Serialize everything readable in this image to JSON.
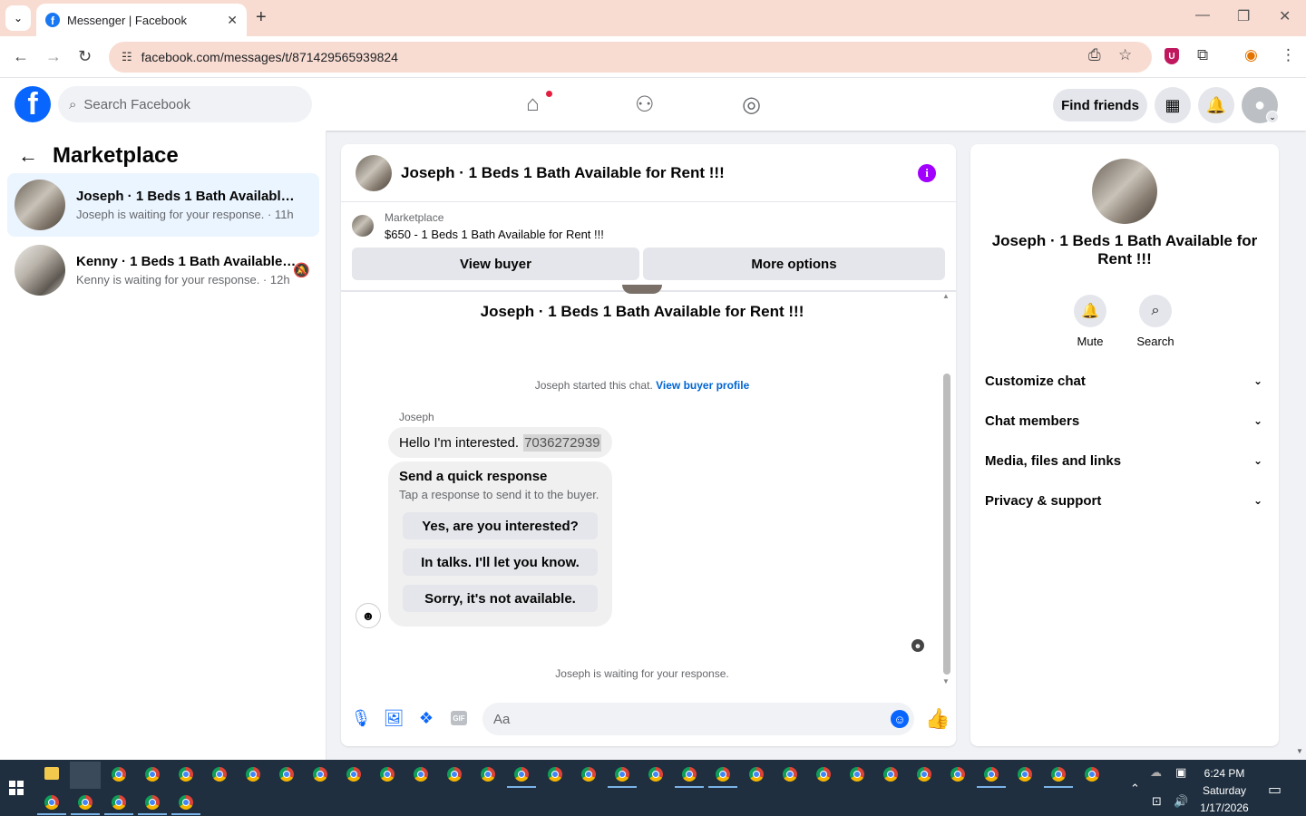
{
  "browser": {
    "tab_title": "Messenger | Facebook",
    "url": "facebook.com/messages/t/871429565939824"
  },
  "fb": {
    "search_placeholder": "Search Facebook",
    "find_friends": "Find friends"
  },
  "sidebar": {
    "title": "Marketplace",
    "conversations": [
      {
        "name": "Joseph · 1 Beds 1 Bath Available for Rent !!!",
        "sub": "Joseph is waiting for your response. · 11h"
      },
      {
        "name": "Kenny · 1 Beds 1 Bath Available for Rent !!!",
        "sub": "Kenny is waiting for your response. · 12h"
      }
    ]
  },
  "chat": {
    "header_title": "Joseph · 1 Beds 1 Bath Available for Rent !!!",
    "listing_label": "Marketplace",
    "listing_price": "$650 - 1 Beds 1 Bath Available for Rent !!!",
    "view_buyer": "View buyer",
    "more_options": "More options",
    "thread_title": "Joseph · 1 Beds 1 Bath Available for Rent !!!",
    "started_text": "Joseph started this chat.",
    "view_buyer_profile": "View buyer profile",
    "sender": "Joseph",
    "message_text": "Hello I'm interested.",
    "message_phone": "7036272939",
    "quick_title": "Send a quick response",
    "quick_sub": "Tap a response to send it to the buyer.",
    "quick_replies": [
      "Yes, are you interested?",
      "In talks. I'll let you know.",
      "Sorry, it's not available."
    ],
    "waiting": "Joseph is waiting for your response.",
    "input_placeholder": "Aa"
  },
  "rpanel": {
    "name": "Joseph · 1 Beds 1 Bath Available for Rent !!!",
    "mute": "Mute",
    "search": "Search",
    "rows": [
      "Customize chat",
      "Chat members",
      "Media, files and links",
      "Privacy & support"
    ]
  },
  "taskbar": {
    "time": "6:24 PM",
    "day": "Saturday",
    "date": "1/17/2026"
  }
}
